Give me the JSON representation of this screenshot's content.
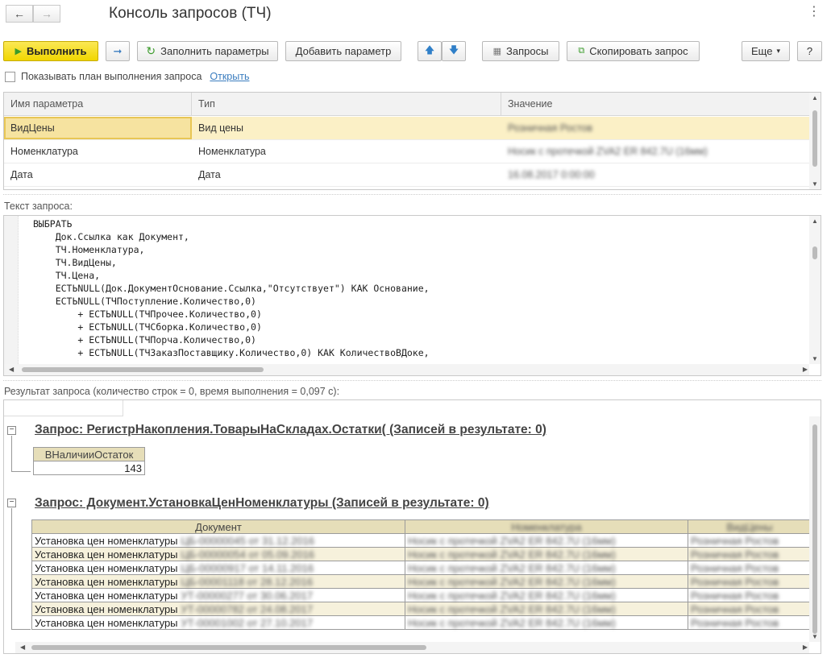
{
  "window": {
    "title": "Консоль запросов (ТЧ)",
    "back_icon": "←",
    "forward_icon": "→",
    "more_icon": "⋮"
  },
  "toolbar": {
    "execute_label": "Выполнить",
    "step_icon": "➞",
    "fill_params_label": "Заполнить параметры",
    "add_param_label": "Добавить параметр",
    "up_icon": "🡅",
    "down_icon": "🡇",
    "queries_label": "Запросы",
    "copy_query_label": "Скопировать запрос",
    "more_label": "Еще",
    "help_label": "?"
  },
  "plan": {
    "checkbox_label": "Показывать план выполнения запроса",
    "open_link": "Открыть"
  },
  "params": {
    "columns": [
      "Имя параметра",
      "Тип",
      "Значение"
    ],
    "rows": [
      {
        "name": "ВидЦены",
        "type": "Вид цены",
        "value": "Розничная Ростов"
      },
      {
        "name": "Номенклатура",
        "type": "Номенклатура",
        "value": "Носик с протечкой ZVA2 ER 842.7U (16мм)"
      },
      {
        "name": "Дата",
        "type": "Дата",
        "value": "16.08.2017 0:00:00"
      }
    ]
  },
  "query": {
    "label": "Текст запроса:",
    "lines": [
      "ВЫБРАТЬ",
      "    Док.Ссылка как Документ,",
      "    ТЧ.Номенклатура,",
      "    ТЧ.ВидЦены,",
      "    ТЧ.Цена,",
      "    ЕСТЬNULL(Док.ДокументОснование.Ссылка,\"Отсутствует\") КАК Основание,",
      "    ЕСТЬNULL(ТЧПоступление.Количество,0)",
      "        + ЕСТЬNULL(ТЧПрочее.Количество,0)",
      "        + ЕСТЬNULL(ТЧСборка.Количество,0)",
      "        + ЕСТЬNULL(ТЧПорча.Количество,0)",
      "        + ЕСТЬNULL(ТЧЗаказПоставщику.Количество,0) КАК КоличествоВДоке,"
    ]
  },
  "result": {
    "label": "Результат запроса (количество строк = 0, время выполнения = 0,097 с):",
    "query1": {
      "title": "Запрос: РегистрНакопления.ТоварыНаСкладах.Остатки( (Записей в результате: 0)",
      "column": "ВНаличииОстаток",
      "value": "143"
    },
    "query2": {
      "title": "Запрос: Документ.УстановкаЦенНоменклатуры (Записей в результате: 0)",
      "columns": [
        "Документ",
        "Номенклатура",
        "ВидЦены"
      ],
      "rows": [
        {
          "doc": "Установка цен номенклатуры",
          "docnum": "ЦБ-00000045 от 31.12.2016",
          "nom": "Носик с протечкой ZVA2 ER 842.7U (16мм)",
          "price": "Розничная Ростов"
        },
        {
          "doc": "Установка цен номенклатуры",
          "docnum": "ЦБ-00000054 от 05.09.2016",
          "nom": "Носик с протечкой ZVA2 ER 842.7U (16мм)",
          "price": "Розничная Ростов"
        },
        {
          "doc": "Установка цен номенклатуры",
          "docnum": "ЦБ-00000917 от 14.11.2016",
          "nom": "Носик с протечкой ZVA2 ER 842.7U (16мм)",
          "price": "Розничная Ростов"
        },
        {
          "doc": "Установка цен номенклатуры",
          "docnum": "ЦБ-00001118 от 28.12.2016",
          "nom": "Носик с протечкой ZVA2 ER 842.7U (16мм)",
          "price": "Розничная Ростов"
        },
        {
          "doc": "Установка цен номенклатуры",
          "docnum": "УТ-00000277 от 30.06.2017",
          "nom": "Носик с протечкой ZVA2 ER 842.7U (16мм)",
          "price": "Розничная Ростов"
        },
        {
          "doc": "Установка цен номенклатуры",
          "docnum": "УТ-00000782 от 24.08.2017",
          "nom": "Носик с протечкой ZVA2 ER 842.7U (16мм)",
          "price": "Розничная Ростов"
        },
        {
          "doc": "Установка цен номенклатуры",
          "docnum": "УТ-00001002 от 27.10.2017",
          "nom": "Носик с протечкой ZVA2 ER 842.7U (16мм)",
          "price": "Розничная Ростов"
        }
      ]
    }
  }
}
